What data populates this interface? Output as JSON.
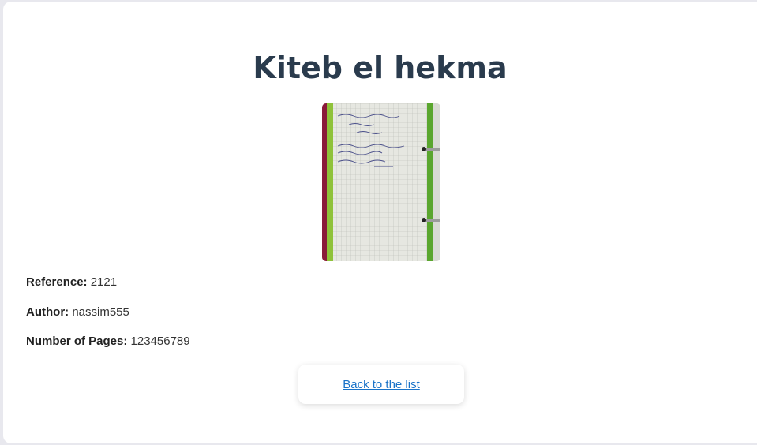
{
  "book": {
    "title": "Kiteb el hekma",
    "reference_label": "Reference:",
    "reference_value": "2121",
    "author_label": "Author:",
    "author_value": "nassim555",
    "pages_label": "Number of Pages:",
    "pages_value": "123456789",
    "cover_image": "notebook-page-photo"
  },
  "nav": {
    "back_label": "Back to the list"
  },
  "colors": {
    "title": "#2a3b4d",
    "link": "#1a73c8",
    "background": "#e8e8ee",
    "card": "#ffffff"
  }
}
